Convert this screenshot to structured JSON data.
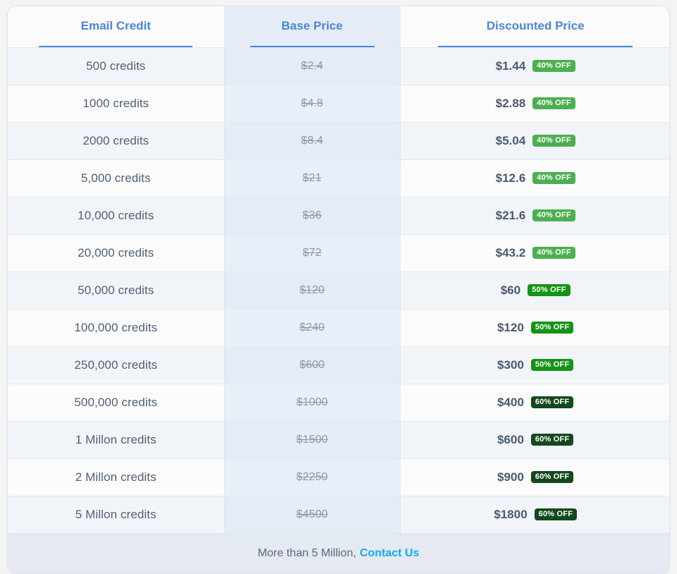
{
  "table": {
    "headers": {
      "credit": "Email Credit",
      "base": "Base Price",
      "discount": "Discounted Price"
    },
    "rows": [
      {
        "credit": "500 credits",
        "base": "$2.4",
        "discount": "$1.44",
        "badge": "40% OFF",
        "tier": "40"
      },
      {
        "credit": "1000 credits",
        "base": "$4.8",
        "discount": "$2.88",
        "badge": "40% OFF",
        "tier": "40"
      },
      {
        "credit": "2000 credits",
        "base": "$8.4",
        "discount": "$5.04",
        "badge": "40% OFF",
        "tier": "40"
      },
      {
        "credit": "5,000 credits",
        "base": "$21",
        "discount": "$12.6",
        "badge": "40% OFF",
        "tier": "40"
      },
      {
        "credit": "10,000 credits",
        "base": "$36",
        "discount": "$21.6",
        "badge": "40% OFF",
        "tier": "40"
      },
      {
        "credit": "20,000 credits",
        "base": "$72",
        "discount": "$43.2",
        "badge": "40% OFF",
        "tier": "40"
      },
      {
        "credit": "50,000 credits",
        "base": "$120",
        "discount": "$60",
        "badge": "50% OFF",
        "tier": "50"
      },
      {
        "credit": "100,000 credits",
        "base": "$240",
        "discount": "$120",
        "badge": "50% OFF",
        "tier": "50"
      },
      {
        "credit": "250,000 credits",
        "base": "$600",
        "discount": "$300",
        "badge": "50% OFF",
        "tier": "50"
      },
      {
        "credit": "500,000 credits",
        "base": "$1000",
        "discount": "$400",
        "badge": "60% OFF",
        "tier": "60"
      },
      {
        "credit": "1 Millon credits",
        "base": "$1500",
        "discount": "$600",
        "badge": "60% OFF",
        "tier": "60"
      },
      {
        "credit": "2 Millon credits",
        "base": "$2250",
        "discount": "$900",
        "badge": "60% OFF",
        "tier": "60"
      },
      {
        "credit": "5 Millon credits",
        "base": "$4500",
        "discount": "$1800",
        "badge": "60% OFF",
        "tier": "60"
      }
    ]
  },
  "footer": {
    "text": "More than 5 Million,",
    "link_label": "Contact Us"
  },
  "colors": {
    "header_text": "#4a86d4",
    "badge_40": "#4caf50",
    "badge_50": "#149414",
    "badge_60": "#14491e",
    "link": "#13aaf0"
  }
}
